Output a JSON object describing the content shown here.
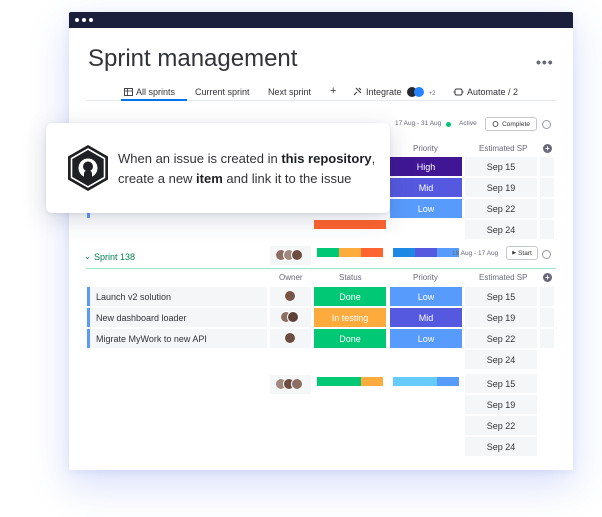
{
  "app": {
    "title": "Sprint management",
    "more_icon": "more-horizontal-icon"
  },
  "tabs": [
    {
      "label": "All sprints",
      "icon": "table-icon",
      "active": true
    },
    {
      "label": "Current sprint"
    },
    {
      "label": "Next sprint"
    },
    {
      "label": "+"
    },
    {
      "label": "Integrate",
      "icon": "integrate-icon",
      "badge": "+2"
    },
    {
      "label": "Automate / 2",
      "icon": "robot-icon"
    }
  ],
  "sprint_top": {
    "dates": "17 Aug - 31 Aug",
    "status": "Active",
    "button": "Complete",
    "columns": {
      "priority": "Priority",
      "estimated": "Estimated SP"
    },
    "priority": [
      "High",
      "Mid",
      "Low"
    ],
    "sp_dates": [
      "Sep 15",
      "Sep 19",
      "Sep 22",
      "Sep 24"
    ]
  },
  "popup": {
    "text_1": "When an issue is created in ",
    "bold_1": "this repository",
    "text_2": ", create a new ",
    "bold_2": "item",
    "text_3": " and link it to the issue",
    "icon": "github-icon"
  },
  "sprint_138": {
    "name": "Sprint 138",
    "dates": "18 Aug - 17 Aug",
    "button": "Start",
    "columns": {
      "owner": "Owner",
      "status": "Status",
      "priority": "Priority",
      "estimated": "Estimated SP"
    },
    "rows": [
      {
        "task": "Launch v2 solution",
        "status": "Done",
        "priority": "Low",
        "sp": "Sep 15"
      },
      {
        "task": "New dashboard loader",
        "status": "In testing",
        "priority": "Mid",
        "sp": "Sep 19"
      },
      {
        "task": "Migrate MyWork to new API",
        "status": "Done",
        "priority": "Low",
        "sp": "Sep 22"
      }
    ],
    "extra_sp": "Sep 24"
  },
  "bottom_group": {
    "sp_dates": [
      "Sep 15",
      "Sep 19",
      "Sep 22",
      "Sep 24"
    ]
  },
  "colors": {
    "done": "#00c875",
    "testing": "#fdab3d",
    "stuck": "#ff642e",
    "high": "#401694",
    "mid": "#5559df",
    "low": "#579bfc",
    "accent": "#0073ea",
    "sprint_green": "#037f4c"
  }
}
